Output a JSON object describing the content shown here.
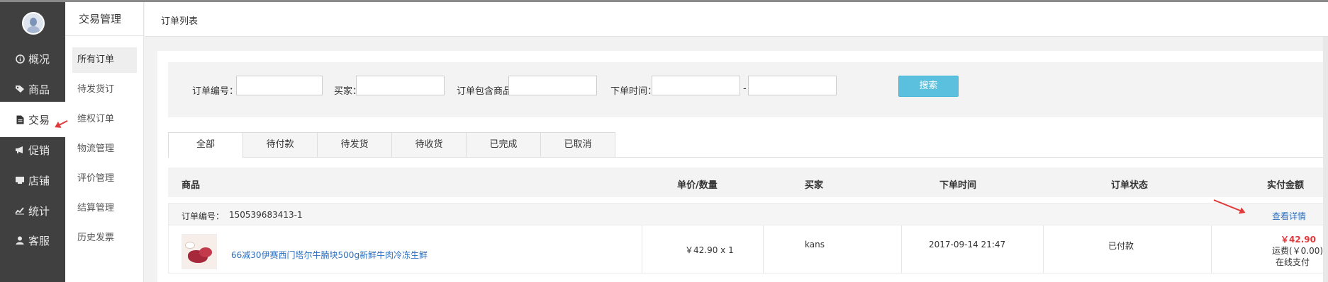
{
  "sidebar": {
    "items": [
      {
        "icon": "info-circle-icon",
        "label": "概况"
      },
      {
        "icon": "tag-icon",
        "label": "商品"
      },
      {
        "icon": "document-icon",
        "label": "交易"
      },
      {
        "icon": "megaphone-icon",
        "label": "促销"
      },
      {
        "icon": "store-icon",
        "label": "店铺"
      },
      {
        "icon": "chart-line-icon",
        "label": "统计"
      },
      {
        "icon": "user-icon",
        "label": "客服"
      }
    ],
    "active": "交易"
  },
  "subnav": {
    "title": "交易管理",
    "items": [
      "所有订单",
      "待发货订",
      "维权订单",
      "物流管理",
      "评价管理",
      "结算管理",
      "历史发票"
    ],
    "active": "所有订单"
  },
  "header": {
    "title": "订单列表"
  },
  "filters": {
    "order_no_label": "订单编号：",
    "buyer_label": "买家：",
    "goods_label": "订单包含商品：",
    "time_label": "下单时间：",
    "time_separator": "-",
    "search_label": "搜索",
    "order_no_value": "",
    "buyer_value": "",
    "goods_value": "",
    "time_from": "",
    "time_to": ""
  },
  "tabs": [
    "全部",
    "待付款",
    "待发货",
    "待收货",
    "已完成",
    "已取消"
  ],
  "table": {
    "headers": [
      "商品",
      "单价/数量",
      "买家",
      "下单时间",
      "订单状态",
      "实付金额"
    ]
  },
  "order": {
    "no_label": "订单编号：",
    "no": "150539683413-1",
    "detail_link": "查看详情",
    "product_name": "66减30伊赛西门塔尔牛腩块500g新鲜牛肉冷冻生鲜",
    "price_qty": "￥42.90 x 1",
    "buyer": "kans",
    "order_time": "2017-09-14 21:47",
    "status": "已付款",
    "paid": "￥42.90",
    "shipping": "运费(￥0.00)",
    "pay_method": "在线支付"
  },
  "colors": {
    "accent": "#5bc0de",
    "link": "#2a6ec0",
    "price": "#e4393c",
    "sidebar": "#404040"
  }
}
